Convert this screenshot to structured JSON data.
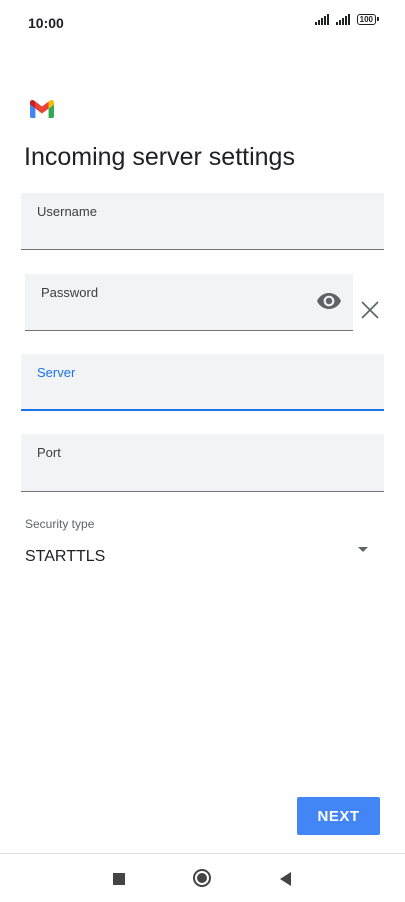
{
  "status_bar": {
    "time": "10:00",
    "battery": "100"
  },
  "app": {
    "logo": "gmail-logo"
  },
  "page": {
    "title": "Incoming server settings"
  },
  "form": {
    "username": {
      "label": "Username",
      "value": ""
    },
    "password": {
      "label": "Password",
      "value": ""
    },
    "server": {
      "label": "Server",
      "value": "",
      "focused": true
    },
    "port": {
      "label": "Port",
      "value": ""
    },
    "security_type": {
      "label": "Security type",
      "value": "STARTTLS"
    }
  },
  "actions": {
    "next_label": "NEXT"
  },
  "colors": {
    "accent": "#1a73e8",
    "button": "#4285f4",
    "field_bg": "#f1f3f4"
  },
  "icons": {
    "password_toggle": "eye-icon",
    "clear": "close-icon",
    "dropdown": "dropdown-arrow-icon"
  }
}
